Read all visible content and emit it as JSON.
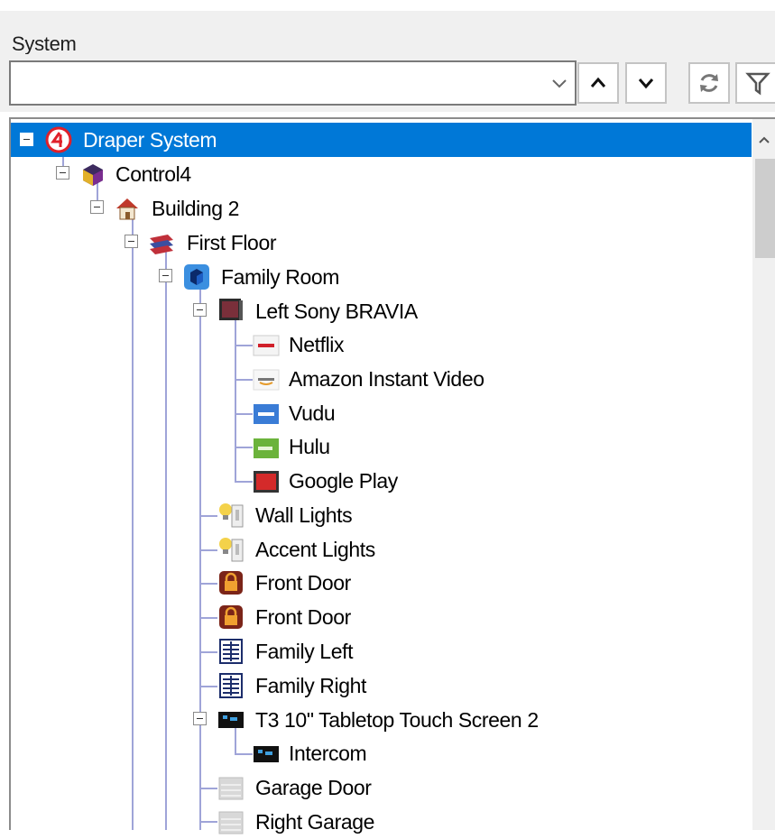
{
  "panel": {
    "title": "System"
  },
  "toolbar": {
    "combo_value": "",
    "icons": [
      "chevron-down-icon",
      "arrow-up-icon",
      "arrow-down-icon",
      "refresh-icon",
      "filter-icon"
    ]
  },
  "tree": {
    "root": {
      "label": "Draper System",
      "icon": "control4-logo-icon",
      "selected": true
    },
    "control4": {
      "label": "Control4",
      "icon": "control4-project-icon"
    },
    "building": {
      "label": "Building 2",
      "icon": "house-icon"
    },
    "floor": {
      "label": "First Floor",
      "icon": "floor-icon"
    },
    "room": {
      "label": "Family Room",
      "icon": "room-cube-icon"
    },
    "tv": {
      "label": "Left Sony BRAVIA",
      "icon": "tv-icon"
    },
    "services": [
      {
        "label": "Netflix",
        "icon": "netflix-icon"
      },
      {
        "label": "Amazon Instant Video",
        "icon": "amazon-icon"
      },
      {
        "label": "Vudu",
        "icon": "vudu-icon"
      },
      {
        "label": "Hulu",
        "icon": "hulu-icon"
      },
      {
        "label": "Google Play",
        "icon": "google-play-icon"
      }
    ],
    "devices": [
      {
        "label": "Wall Lights",
        "icon": "light-switch-icon"
      },
      {
        "label": "Accent Lights",
        "icon": "light-switch-icon"
      },
      {
        "label": "Front Door",
        "icon": "door-lock-icon"
      },
      {
        "label": "Front Door",
        "icon": "door-lock-icon"
      },
      {
        "label": "Family Left",
        "icon": "keypad-icon"
      },
      {
        "label": "Family Right",
        "icon": "keypad-icon"
      }
    ],
    "touchscreen": {
      "label": "T3 10\" Tabletop Touch Screen 2",
      "icon": "touchscreen-icon"
    },
    "intercom": {
      "label": "Intercom",
      "icon": "intercom-icon"
    },
    "garage": [
      {
        "label": "Garage Door",
        "icon": "garage-door-icon"
      },
      {
        "label": "Right Garage",
        "icon": "garage-door-icon"
      }
    ]
  },
  "colors": {
    "selection": "#0078d7",
    "tree_lines": "#9fa4d8"
  }
}
